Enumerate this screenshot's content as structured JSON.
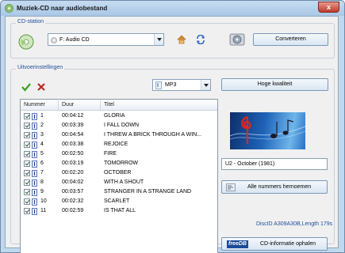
{
  "window": {
    "title": "Muziek-CD naar audiobestand",
    "close_symbol": "x"
  },
  "cd_station": {
    "group_label": "CD-station",
    "drive_value": "F: Audio CD",
    "convert_button": "Converteren"
  },
  "output_settings": {
    "group_label": "Uitvoerinstellingen",
    "format_value": "MP3",
    "quality_button": "Hoge kwaliteit"
  },
  "table": {
    "columns": {
      "number": "Nummer",
      "duration": "Duur",
      "title": "Titel"
    },
    "rows": [
      {
        "number": "1",
        "duration": "00:04:12",
        "title": "GLORIA"
      },
      {
        "number": "2",
        "duration": "00:03:39",
        "title": "I FALL DOWN"
      },
      {
        "number": "3",
        "duration": "00:04:54",
        "title": "I THREW A BRICK THROUGH A WIN..."
      },
      {
        "number": "4",
        "duration": "00:03:38",
        "title": "REJOICE"
      },
      {
        "number": "5",
        "duration": "00:02:50",
        "title": "FIRE"
      },
      {
        "number": "6",
        "duration": "00:03:19",
        "title": "TOMORROW"
      },
      {
        "number": "7",
        "duration": "00:02:20",
        "title": "OCTOBER"
      },
      {
        "number": "8",
        "duration": "00:04:02",
        "title": "WITH A SHOUT"
      },
      {
        "number": "9",
        "duration": "00:03:57",
        "title": "STRANGER IN A STRANGE LAND"
      },
      {
        "number": "10",
        "duration": "00:02:32",
        "title": "SCARLET"
      },
      {
        "number": "11",
        "duration": "00:02:59",
        "title": "IS THAT ALL"
      }
    ]
  },
  "album": {
    "name": "U2 - October (1981)",
    "rename_button": "Alle nummers hernoemen",
    "disc_id": "DiscID A309A30B,Length 179s",
    "freedb_logo": "freeDB",
    "cd_info_button": "CD-informatie ophalen"
  },
  "colors": {
    "window_frame": "#bfd8ee",
    "group_label": "#1e4e9c",
    "disc_id_text": "#1e4e9c",
    "check_green": "#3aa020",
    "cross_red": "#c0281c"
  },
  "icons": [
    "app-cd-icon",
    "eject-icon",
    "refresh-icon",
    "cd-drive-icon",
    "check-all-icon",
    "uncheck-all-icon",
    "music-file-icon",
    "rename-icon"
  ]
}
